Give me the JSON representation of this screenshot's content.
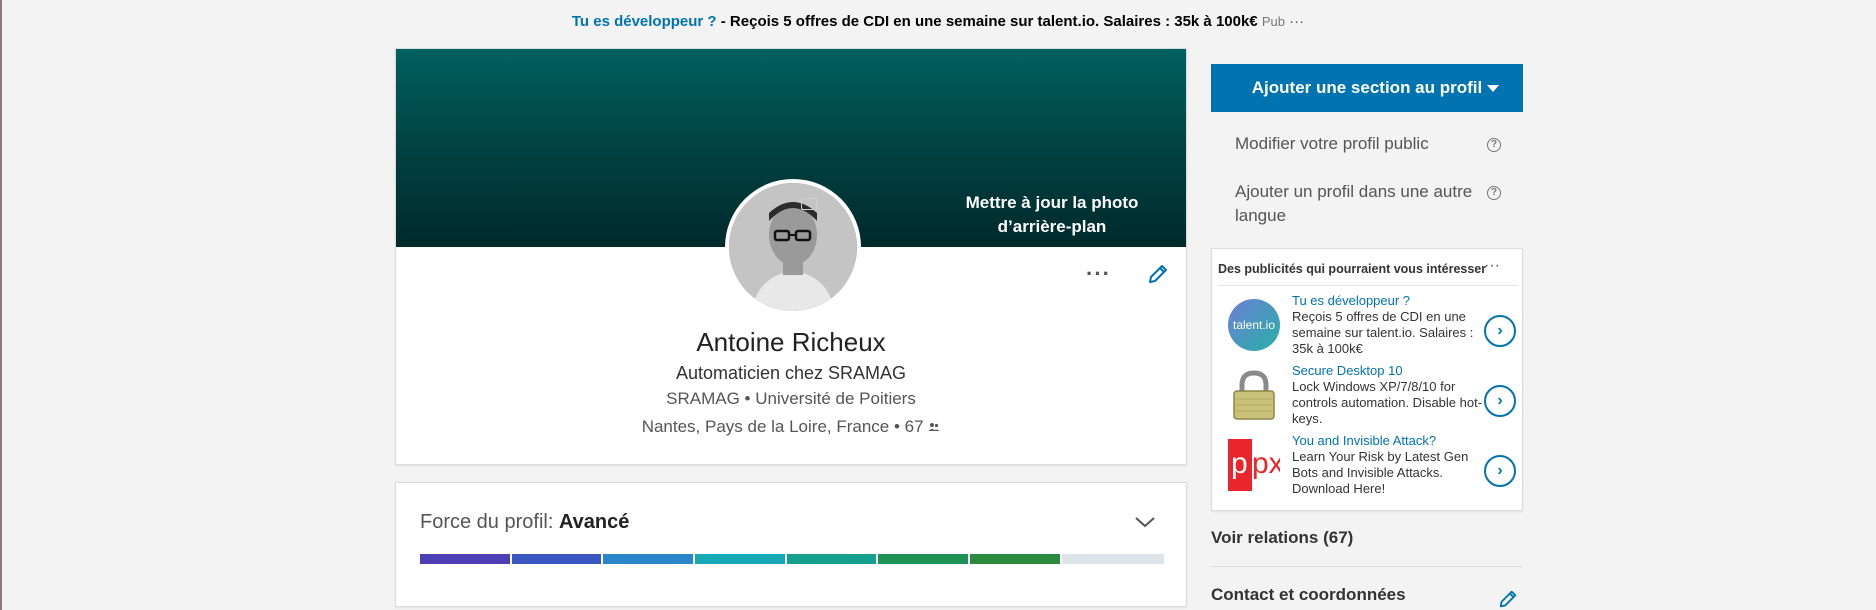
{
  "top_ad": {
    "link": "Tu es développeur ?",
    "text": " - Reçois 5 offres de CDI en une semaine sur talent.io. Salaires : 35k à 100k€",
    "pub": "Pub",
    "dots": "···"
  },
  "profile": {
    "cover_label": "Mettre à jour la photo d’arrière-plan",
    "more_label": "···",
    "name": "Antoine Richeux",
    "headline": "Automaticien chez SRAMAG",
    "orgs": "SRAMAG • Université de Poitiers",
    "location": "Nantes, Pays de la Loire, France • 67"
  },
  "strength": {
    "label": "Force du profil: ",
    "level": "Avancé",
    "progress": 0.86,
    "colors": [
      "#4f3fb5",
      "#3a57c2",
      "#2a86c9",
      "#17a9b4",
      "#14a08d",
      "#1f9155",
      "#2b8a3e"
    ],
    "empty_color": "#dde4ea"
  },
  "sidebar": {
    "add_section": "Ajouter une section au profil",
    "edit_public": "Modifier votre profil public",
    "add_language": "Ajouter un profil dans une autre langue",
    "help_glyph": "?",
    "voir": "Voir relations (67)",
    "contact": "Contact et coordonnées"
  },
  "ads": {
    "title": "Des publicités qui pourraient vous intéresser",
    "dots": "···",
    "items": [
      {
        "title": "Tu es développeur ?",
        "text": "Reçois 5 offres de CDI en une semaine sur talent.io. Salaires : 35k à 100k€",
        "logo": "talent.io"
      },
      {
        "title": "Secure Desktop 10",
        "text": "Lock Windows XP/7/8/10 for controls automation. Disable hot-keys.",
        "logo": "padlock-icon"
      },
      {
        "title": "You and Invisible Attack?",
        "text": "Learn Your Risk by Latest Gen Bots and Invisible Attacks. Download Here!",
        "logo": "px"
      }
    ],
    "arrow": "›"
  },
  "colors": {
    "accent": "#0073b1",
    "cover": "#013f3f"
  }
}
